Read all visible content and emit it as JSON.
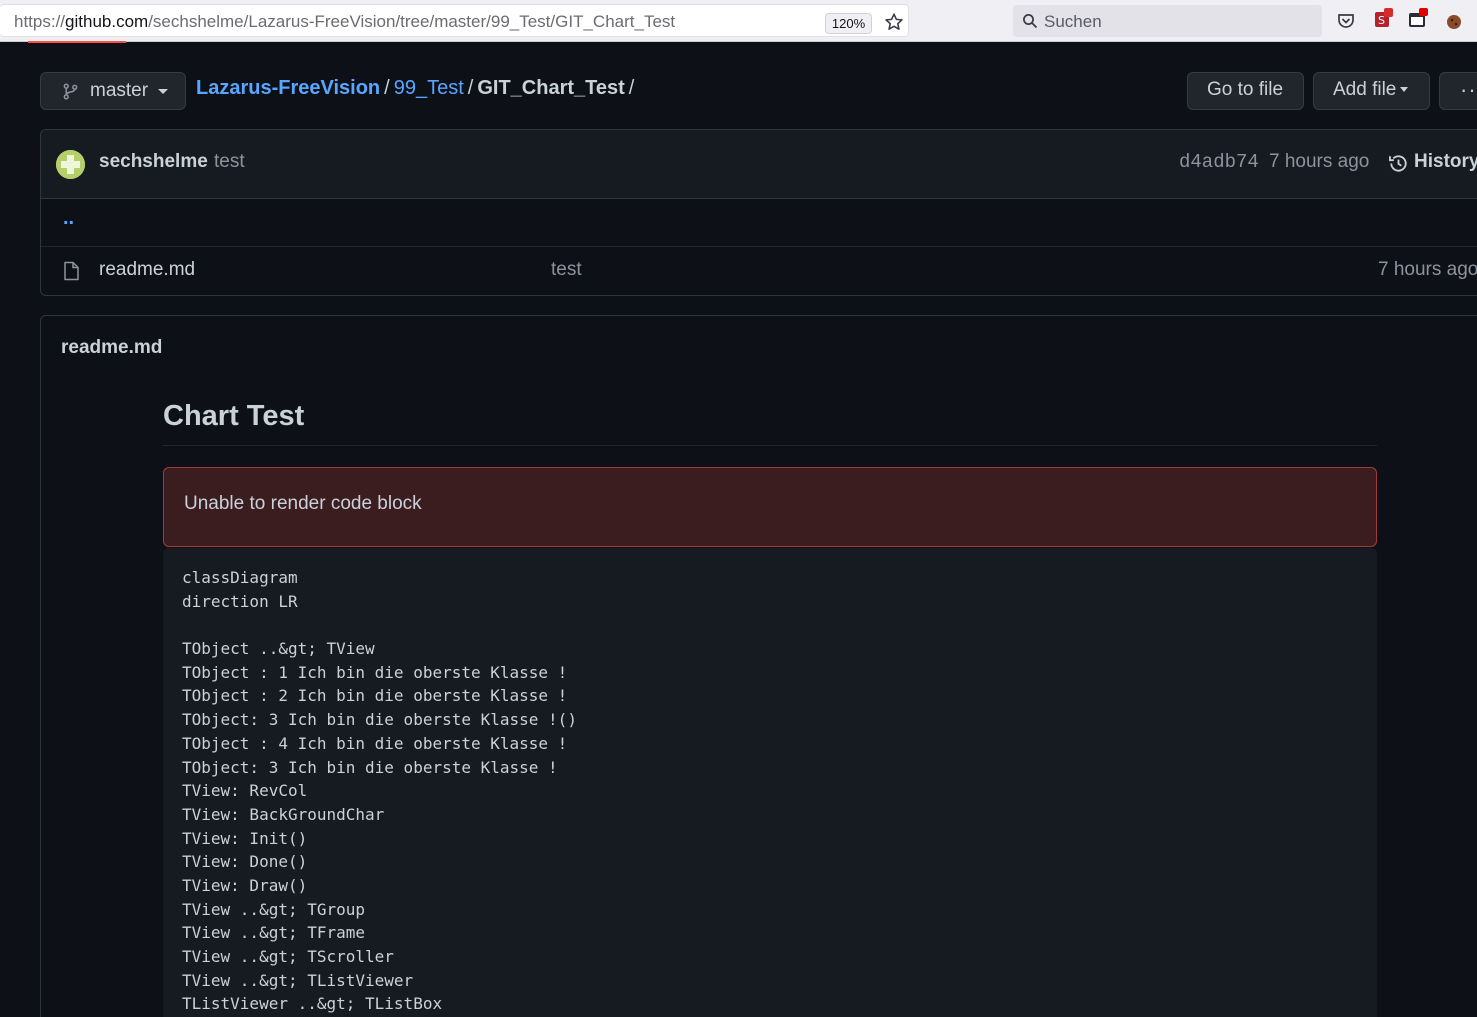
{
  "browser": {
    "url_scheme": "https://",
    "url_domain": "github.com",
    "url_path": "/sechshelme/Lazarus-FreeVision/tree/master/99_Test/GIT_Chart_Test",
    "zoom": "120%",
    "search_placeholder": "Suchen"
  },
  "repo": {
    "branch": "master",
    "breadcrumb": {
      "root": "Lazarus-FreeVision",
      "sep": "/",
      "folder": "99_Test",
      "current": "GIT_Chart_Test",
      "trailing": "/"
    },
    "go_to_file": "Go to file",
    "add_file": "Add file",
    "more": "···"
  },
  "commit": {
    "author": "sechshelme",
    "message": "test",
    "hash": "d4adb74",
    "time": "7 hours ago",
    "history_label": "History"
  },
  "files": {
    "parent": "..",
    "rows": [
      {
        "name": "readme.md",
        "commit": "test",
        "age": "7 hours ago"
      }
    ]
  },
  "readme": {
    "title": "readme.md",
    "heading": "Chart Test",
    "error": "Unable to render code block",
    "code_lines": [
      "classDiagram",
      "direction LR",
      "",
      "TObject ..&gt; TView",
      "TObject : 1 Ich bin die oberste Klasse !",
      "TObject : 2 Ich bin die oberste Klasse !",
      "TObject: 3 Ich bin die oberste Klasse !()",
      "TObject : 4 Ich bin die oberste Klasse !",
      "TObject: 3 Ich bin die oberste Klasse !",
      "TView: RevCol",
      "TView: BackGroundChar",
      "TView: Init()",
      "TView: Done()",
      "TView: Draw()",
      "TView ..&gt; TGroup",
      "TView ..&gt; TFrame",
      "TView ..&gt; TScroller",
      "TView ..&gt; TListViewer",
      "TListViewer ..&gt; TListBox"
    ]
  }
}
